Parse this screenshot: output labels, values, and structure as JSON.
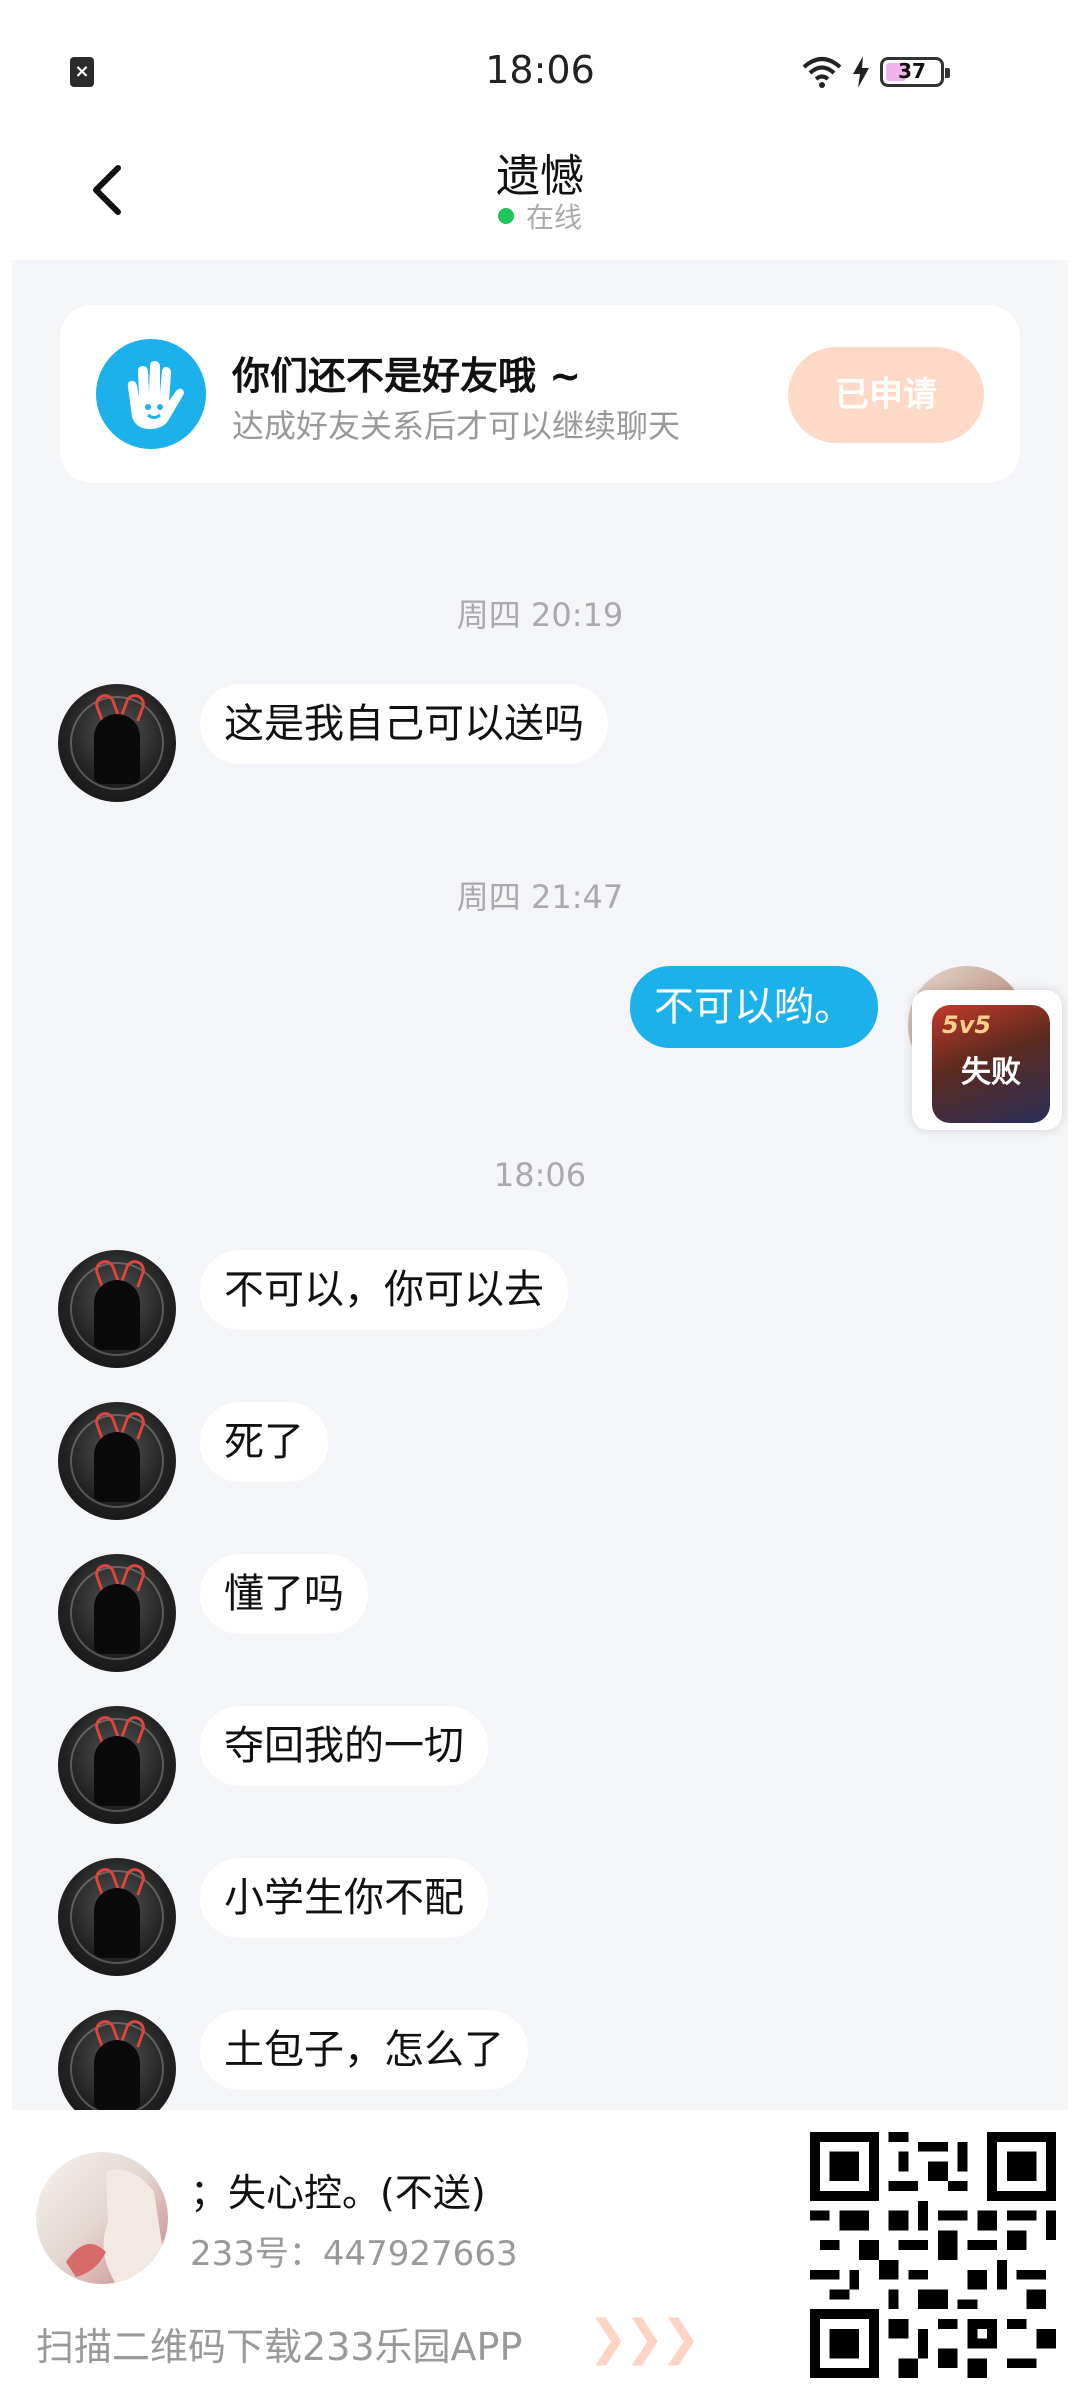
{
  "status_bar": {
    "time": "18:06",
    "battery": "37"
  },
  "header": {
    "title": "遗憾",
    "status": "在线"
  },
  "friend_card": {
    "title": "你们还不是好友哦 ~",
    "subtitle": "达成好友关系后才可以继续聊天",
    "button": "已申请"
  },
  "messages": {
    "ts1": "周四 20:19",
    "m1": "这是我自己可以送吗",
    "ts2": "周四 21:47",
    "m2": "不可以哟。",
    "ts3": "18:06",
    "m3": "不可以，你可以去",
    "m4": "死了",
    "m5": "懂了吗",
    "m6": "夺回我的一切",
    "m7": "小学生你不配",
    "m8": "土包子，怎么了"
  },
  "floating_widget": {
    "badge": "5v5",
    "label": "失败"
  },
  "promo": {
    "name": "；失心控。(不送)",
    "id": "233号：447927663",
    "scan": "扫描二维码下载233乐园APP",
    "arrows": "❯❯❯"
  },
  "colors": {
    "accent": "#1cb1ea",
    "chat_bg": "#f3f5f8",
    "button_applied": "#ffd9c7",
    "online_dot": "#1fc45a"
  }
}
